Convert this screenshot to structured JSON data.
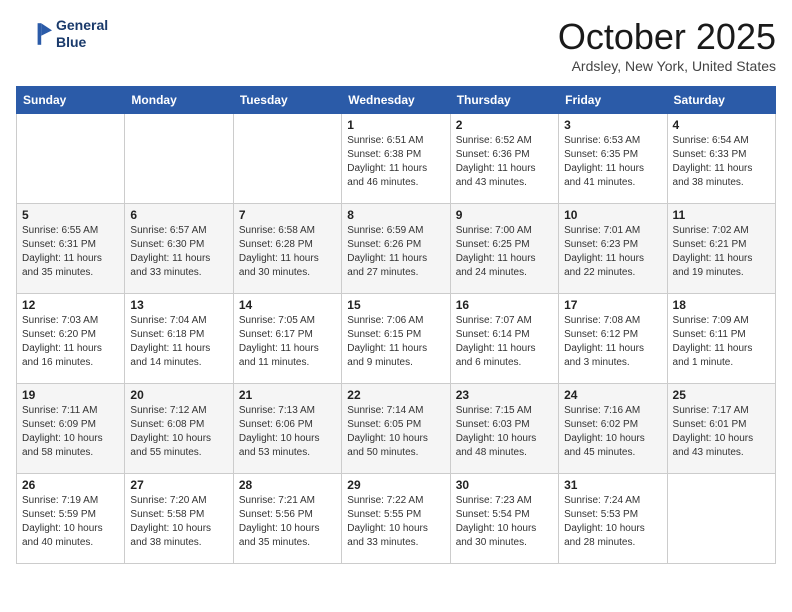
{
  "header": {
    "logo_line1": "General",
    "logo_line2": "Blue",
    "month": "October 2025",
    "location": "Ardsley, New York, United States"
  },
  "weekdays": [
    "Sunday",
    "Monday",
    "Tuesday",
    "Wednesday",
    "Thursday",
    "Friday",
    "Saturday"
  ],
  "weeks": [
    [
      {
        "day": "",
        "info": ""
      },
      {
        "day": "",
        "info": ""
      },
      {
        "day": "",
        "info": ""
      },
      {
        "day": "1",
        "info": "Sunrise: 6:51 AM\nSunset: 6:38 PM\nDaylight: 11 hours\nand 46 minutes."
      },
      {
        "day": "2",
        "info": "Sunrise: 6:52 AM\nSunset: 6:36 PM\nDaylight: 11 hours\nand 43 minutes."
      },
      {
        "day": "3",
        "info": "Sunrise: 6:53 AM\nSunset: 6:35 PM\nDaylight: 11 hours\nand 41 minutes."
      },
      {
        "day": "4",
        "info": "Sunrise: 6:54 AM\nSunset: 6:33 PM\nDaylight: 11 hours\nand 38 minutes."
      }
    ],
    [
      {
        "day": "5",
        "info": "Sunrise: 6:55 AM\nSunset: 6:31 PM\nDaylight: 11 hours\nand 35 minutes."
      },
      {
        "day": "6",
        "info": "Sunrise: 6:57 AM\nSunset: 6:30 PM\nDaylight: 11 hours\nand 33 minutes."
      },
      {
        "day": "7",
        "info": "Sunrise: 6:58 AM\nSunset: 6:28 PM\nDaylight: 11 hours\nand 30 minutes."
      },
      {
        "day": "8",
        "info": "Sunrise: 6:59 AM\nSunset: 6:26 PM\nDaylight: 11 hours\nand 27 minutes."
      },
      {
        "day": "9",
        "info": "Sunrise: 7:00 AM\nSunset: 6:25 PM\nDaylight: 11 hours\nand 24 minutes."
      },
      {
        "day": "10",
        "info": "Sunrise: 7:01 AM\nSunset: 6:23 PM\nDaylight: 11 hours\nand 22 minutes."
      },
      {
        "day": "11",
        "info": "Sunrise: 7:02 AM\nSunset: 6:21 PM\nDaylight: 11 hours\nand 19 minutes."
      }
    ],
    [
      {
        "day": "12",
        "info": "Sunrise: 7:03 AM\nSunset: 6:20 PM\nDaylight: 11 hours\nand 16 minutes."
      },
      {
        "day": "13",
        "info": "Sunrise: 7:04 AM\nSunset: 6:18 PM\nDaylight: 11 hours\nand 14 minutes."
      },
      {
        "day": "14",
        "info": "Sunrise: 7:05 AM\nSunset: 6:17 PM\nDaylight: 11 hours\nand 11 minutes."
      },
      {
        "day": "15",
        "info": "Sunrise: 7:06 AM\nSunset: 6:15 PM\nDaylight: 11 hours\nand 9 minutes."
      },
      {
        "day": "16",
        "info": "Sunrise: 7:07 AM\nSunset: 6:14 PM\nDaylight: 11 hours\nand 6 minutes."
      },
      {
        "day": "17",
        "info": "Sunrise: 7:08 AM\nSunset: 6:12 PM\nDaylight: 11 hours\nand 3 minutes."
      },
      {
        "day": "18",
        "info": "Sunrise: 7:09 AM\nSunset: 6:11 PM\nDaylight: 11 hours\nand 1 minute."
      }
    ],
    [
      {
        "day": "19",
        "info": "Sunrise: 7:11 AM\nSunset: 6:09 PM\nDaylight: 10 hours\nand 58 minutes."
      },
      {
        "day": "20",
        "info": "Sunrise: 7:12 AM\nSunset: 6:08 PM\nDaylight: 10 hours\nand 55 minutes."
      },
      {
        "day": "21",
        "info": "Sunrise: 7:13 AM\nSunset: 6:06 PM\nDaylight: 10 hours\nand 53 minutes."
      },
      {
        "day": "22",
        "info": "Sunrise: 7:14 AM\nSunset: 6:05 PM\nDaylight: 10 hours\nand 50 minutes."
      },
      {
        "day": "23",
        "info": "Sunrise: 7:15 AM\nSunset: 6:03 PM\nDaylight: 10 hours\nand 48 minutes."
      },
      {
        "day": "24",
        "info": "Sunrise: 7:16 AM\nSunset: 6:02 PM\nDaylight: 10 hours\nand 45 minutes."
      },
      {
        "day": "25",
        "info": "Sunrise: 7:17 AM\nSunset: 6:01 PM\nDaylight: 10 hours\nand 43 minutes."
      }
    ],
    [
      {
        "day": "26",
        "info": "Sunrise: 7:19 AM\nSunset: 5:59 PM\nDaylight: 10 hours\nand 40 minutes."
      },
      {
        "day": "27",
        "info": "Sunrise: 7:20 AM\nSunset: 5:58 PM\nDaylight: 10 hours\nand 38 minutes."
      },
      {
        "day": "28",
        "info": "Sunrise: 7:21 AM\nSunset: 5:56 PM\nDaylight: 10 hours\nand 35 minutes."
      },
      {
        "day": "29",
        "info": "Sunrise: 7:22 AM\nSunset: 5:55 PM\nDaylight: 10 hours\nand 33 minutes."
      },
      {
        "day": "30",
        "info": "Sunrise: 7:23 AM\nSunset: 5:54 PM\nDaylight: 10 hours\nand 30 minutes."
      },
      {
        "day": "31",
        "info": "Sunrise: 7:24 AM\nSunset: 5:53 PM\nDaylight: 10 hours\nand 28 minutes."
      },
      {
        "day": "",
        "info": ""
      }
    ]
  ]
}
